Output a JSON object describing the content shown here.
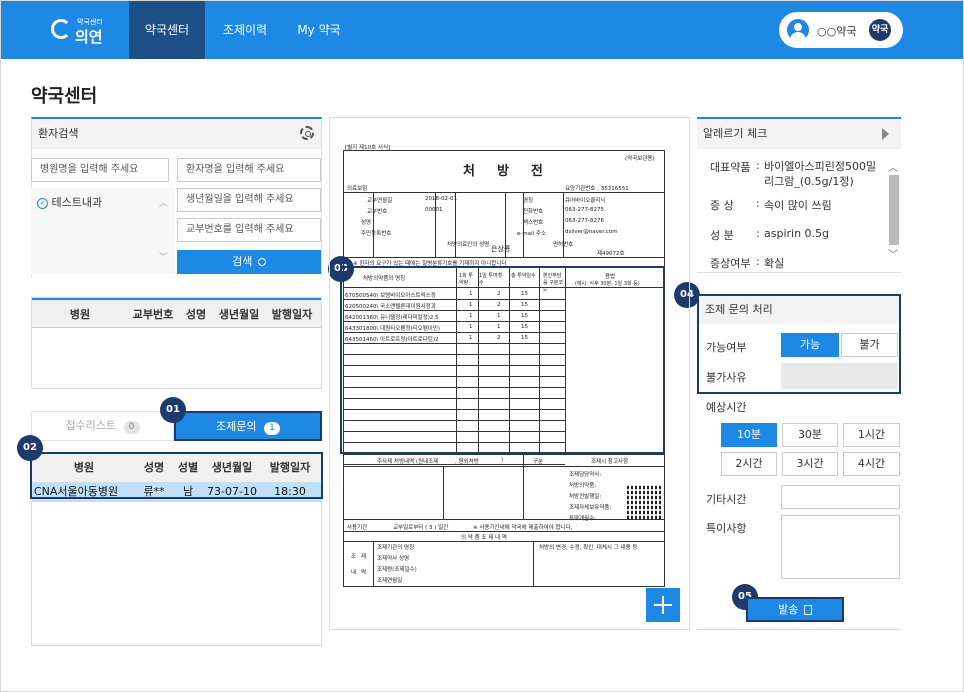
{
  "brand": {
    "sub": "약국센터",
    "name": "의연"
  },
  "nav": [
    {
      "label": "약국센터",
      "active": true
    },
    {
      "label": "조제이력",
      "active": false
    },
    {
      "label": "My 약국",
      "active": false
    }
  ],
  "user": {
    "name": "○○약국",
    "badge": "약국"
  },
  "page_title": "약국센터",
  "patient_search": {
    "title": "환자검색",
    "hospital_placeholder": "병원명을 입력해 주세요",
    "patient_placeholder": "환자명을 입력해 주세요",
    "birth_placeholder": "생년월일을 입력해 주세요",
    "number_placeholder": "교부번호를 입력해 주세요",
    "department": "테스트내과",
    "search_label": "검색"
  },
  "result_table": {
    "headers": [
      "병원",
      "교부번호",
      "성명",
      "생년월일",
      "발행일자"
    ]
  },
  "tabs": {
    "reception": {
      "label": "접수리스트",
      "count": "0"
    },
    "inquiry": {
      "label": "조제문의",
      "count": "1"
    }
  },
  "inquiry_table": {
    "headers": [
      "병원",
      "성명",
      "성별",
      "생년월일",
      "발행일자"
    ],
    "rows": [
      {
        "hospital": "CNA서울아동병원",
        "name": "류**",
        "sex": "남",
        "birth": "73-07-10",
        "issued": "18:30"
      }
    ]
  },
  "markers": [
    "01",
    "02",
    "03",
    "04",
    "05"
  ],
  "prescription": {
    "form_no": "[별지 제10호 서식]",
    "insurance": "(약국보관용)",
    "title": "처방전",
    "type_label": "의료보험",
    "issue_label": "교부연월일",
    "issue_date": "2018-02-01",
    "issue_no_label": "교부번호",
    "issue_no": "00001",
    "clinic_no": "요양기관번호 : 35316551",
    "facility_name_label": "명칭",
    "facility_name": "큐어바이오클리닉",
    "phone_label": "전화번호",
    "phone": "063-277-8275",
    "fax_label": "팩스번호",
    "fax": "063-277-8276",
    "email_label": "e-mail 주소",
    "email": "dsilver@naver.com",
    "patient_label": "성명",
    "reg_label": "주민등록번호",
    "doctor_label": "처방의료인의 성명",
    "doctor": "은상룡",
    "license_label": "면허번호",
    "license": "제49072호",
    "notice": "※ 환자의 요구가 있는 때에는 질병분류기호를 기재하지 아니합니다",
    "col_drug": "처방의약품의 명칭",
    "col_dose": "1회 투약량",
    "col_freq": "1일 투여횟수",
    "col_days": "총 투약일수",
    "col_other": "본인부담률 구분코드",
    "col_usage": "용법",
    "col_usage2": "(예시: 식후 30분, 1일 3회 등)",
    "drugs": [
      {
        "name": "670500540\\ 보령바이오아스트릭스정",
        "dose": "1",
        "freq": "2",
        "days": "15"
      },
      {
        "name": "620500240\\ 국소앤텔론데이원사정과",
        "dose": "1",
        "freq": "2",
        "days": "15"
      },
      {
        "name": "642001360\\ 유니텔정(레다피칼정)2.5",
        "dose": "1",
        "freq": "1",
        "days": "15"
      },
      {
        "name": "643301800\\ 대원티오펜정(티오펜이민)",
        "dose": "1",
        "freq": "1",
        "days": "15"
      },
      {
        "name": "643501460\\ 아트로프정(아트로다틴)2",
        "dose": "1",
        "freq": "2",
        "days": "15"
      }
    ],
    "injection": "주사제 처방내역 (원내조제",
    "injection2": ", 원외처방",
    "injection3": ")",
    "dispense_col": "구분",
    "dispense_title": "조제시 참고사항",
    "guide": [
      "조제담당약사:",
      "처방의약품:",
      "처방전발행일:",
      "조제자체보유약품:",
      "투약개월수:"
    ],
    "valid_label": "사용기간",
    "valid": "교부일로부터 ( 3 ) 일간",
    "valid_note": "※ 사용기간내에 약국에 제출하여야 합니다.",
    "dispense_detail": "의 약 품 조 제 내 역",
    "dispense_sections": [
      "조제기관의 명칭",
      "조제약사 성명",
      "조제량(조제일수)",
      "조제연월일"
    ],
    "dispense_side": [
      "조",
      "제",
      "내",
      "역"
    ],
    "change_note": "처방의 변경, 수정, 확인, 대체시 그 내용 등"
  },
  "allergy": {
    "title": "알레르기 체크",
    "rows": [
      {
        "key": "대표약품",
        "value": "바이엘아스피린정500밀리그람_(0.5g/1정)"
      },
      {
        "key": "증 상",
        "value": "속이 많이 쓰림"
      },
      {
        "key": "성 분",
        "value": "aspirin 0.5g"
      },
      {
        "key": "증상여부",
        "value": "확실"
      }
    ]
  },
  "inquiry_process": {
    "title": "조제 문의 처리",
    "possible_label": "가능여부",
    "possible_yes": "가능",
    "possible_no": "불가",
    "reason_label": "불가사유",
    "reason_value": ""
  },
  "eta": {
    "label": "예상시간",
    "options": [
      "10분",
      "30분",
      "1시간",
      "2시간",
      "3시간",
      "4시간"
    ],
    "selected": "10분",
    "other_label": "기타시간",
    "notes_label": "특이사항"
  },
  "send_label": "발송"
}
